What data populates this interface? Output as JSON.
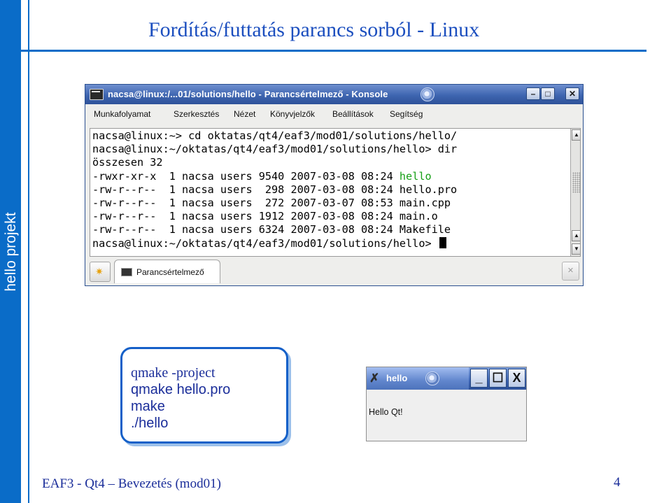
{
  "slide": {
    "title": "Fordítás/futtatás parancs sorból - Linux",
    "side_label": "hello projekt",
    "footer": "EAF3 - Qt4 – Bevezetés (mod01)",
    "page_number": "4"
  },
  "konsole": {
    "title": "nacsa@linux:/...01/solutions/hello - Parancsértelmező - Konsole",
    "window_buttons": {
      "minimize": "–",
      "maximize": "□",
      "close": "✕"
    },
    "menu": [
      "Munkafolyamat",
      "Szerkesztés",
      "Nézet",
      "Könyvjelzők",
      "Beállítások",
      "Segítség"
    ],
    "terminal": {
      "lines": [
        "nacsa@linux:~> cd oktatas/qt4/eaf3/mod01/solutions/hello/",
        "nacsa@linux:~/oktatas/qt4/eaf3/mod01/solutions/hello> dir",
        "összesen 32"
      ],
      "listing": [
        {
          "meta": "-rwxr-xr-x  1 nacsa users 9540 2007-03-08 08:24 ",
          "name": "hello"
        },
        {
          "meta": "-rw-r--r--  1 nacsa users  298 2007-03-08 08:24 ",
          "name": "hello.pro"
        },
        {
          "meta": "-rw-r--r--  1 nacsa users  272 2007-03-07 08:53 ",
          "name": "main.cpp"
        },
        {
          "meta": "-rw-r--r--  1 nacsa users 1912 2007-03-08 08:24 ",
          "name": "main.o"
        },
        {
          "meta": "-rw-r--r--  1 nacsa users 6324 2007-03-08 08:24 ",
          "name": "Makefile"
        }
      ],
      "prompt": "nacsa@linux:~/oktatas/qt4/eaf3/mod01/solutions/hello> ",
      "exec_color": "#17a017"
    },
    "tab_label": "Parancsértelmező"
  },
  "commands": [
    "qmake -project",
    "qmake hello.pro",
    "make",
    "./hello"
  ],
  "hello_window": {
    "title": "hello",
    "buttons": {
      "minimize": "_",
      "maximize": "☐",
      "close": "X"
    },
    "label": "Hello Qt!"
  },
  "colors": {
    "accent": "#0a6cc8",
    "title_text": "#1c4fbf",
    "footer_text": "#1b2e9a"
  }
}
